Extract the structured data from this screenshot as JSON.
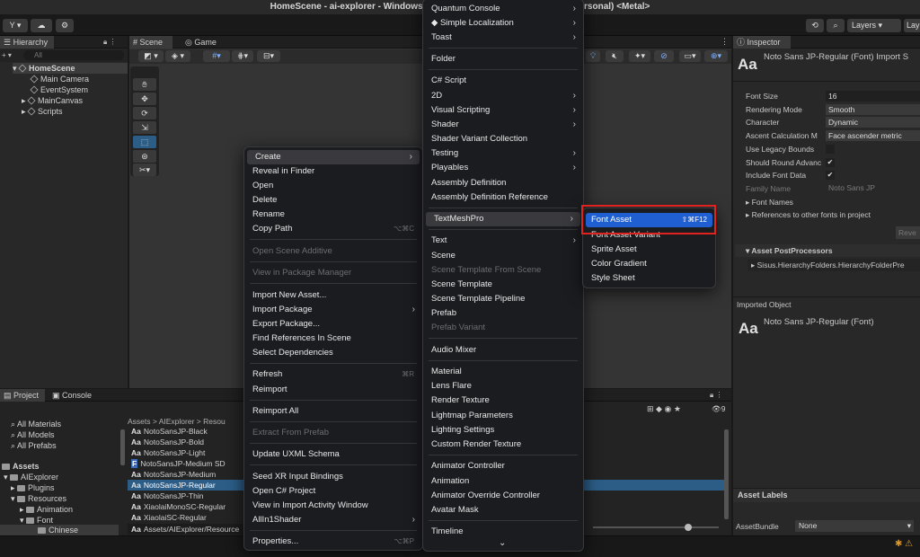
{
  "window": {
    "title": "HomeScene - ai-explorer - Windows, Mac, Linux - Unity 2022 Personal (Personal) <Metal>"
  },
  "toolbar": {
    "account": "Y ▾",
    "layers_label": "Layers",
    "layout_label": "Lay"
  },
  "hierarchy": {
    "tab": "Hierarchy",
    "search_placeholder": "All",
    "items": [
      {
        "label": "HomeScene"
      },
      {
        "label": "Main Camera"
      },
      {
        "label": "EventSystem"
      },
      {
        "label": "MainCanvas"
      },
      {
        "label": "Scripts"
      }
    ]
  },
  "scene": {
    "tabs": [
      {
        "label": "Scene"
      },
      {
        "label": "Game"
      }
    ]
  },
  "project": {
    "tabs": [
      {
        "label": "Project"
      },
      {
        "label": "Console"
      }
    ],
    "favorites": [
      {
        "label": "All Materials"
      },
      {
        "label": "All Models"
      },
      {
        "label": "All Prefabs"
      }
    ],
    "tree": [
      {
        "label": "Assets"
      },
      {
        "label": "AIExplorer"
      },
      {
        "label": "Plugins"
      },
      {
        "label": "Resources"
      },
      {
        "label": "Animation"
      },
      {
        "label": "Font"
      },
      {
        "label": "Chinese"
      }
    ],
    "breadcrumb": "Assets > AIExplorer > Resou",
    "files": [
      {
        "label": "NotoSansJP-Black"
      },
      {
        "label": "NotoSansJP-Bold"
      },
      {
        "label": "NotoSansJP-Light"
      },
      {
        "label": "NotoSansJP-Medium SD"
      },
      {
        "label": "NotoSansJP-Medium"
      },
      {
        "label": "NotoSansJP-Regular"
      },
      {
        "label": "NotoSansJP-Thin"
      },
      {
        "label": "XiaolaiMonoSC-Regular"
      },
      {
        "label": "XiaolaiSC-Regular"
      }
    ],
    "path": "Assets/AIExplorer/Resource",
    "count": "9"
  },
  "context_menu": {
    "items": [
      {
        "label": "Create"
      },
      {
        "label": "Reveal in Finder"
      },
      {
        "label": "Open"
      },
      {
        "label": "Delete"
      },
      {
        "label": "Rename"
      },
      {
        "label": "Copy Path",
        "shortcut": "⌥⌘C"
      },
      {
        "label": "Open Scene Additive"
      },
      {
        "label": "View in Package Manager"
      },
      {
        "label": "Import New Asset..."
      },
      {
        "label": "Import Package"
      },
      {
        "label": "Export Package..."
      },
      {
        "label": "Find References In Scene"
      },
      {
        "label": "Select Dependencies"
      },
      {
        "label": "Refresh",
        "shortcut": "⌘R"
      },
      {
        "label": "Reimport"
      },
      {
        "label": "Reimport All"
      },
      {
        "label": "Extract From Prefab"
      },
      {
        "label": "Update UXML Schema"
      },
      {
        "label": "Seed XR Input Bindings"
      },
      {
        "label": "Open C# Project"
      },
      {
        "label": "View in Import Activity Window"
      },
      {
        "label": "AllIn1Shader"
      },
      {
        "label": "Properties...",
        "shortcut": "⌥⌘P"
      }
    ]
  },
  "create_menu": {
    "items": [
      {
        "label": "Quantum Console"
      },
      {
        "label": "◆ Simple Localization"
      },
      {
        "label": "Toast"
      },
      {
        "label": "Folder"
      },
      {
        "label": "C# Script"
      },
      {
        "label": "2D"
      },
      {
        "label": "Visual Scripting"
      },
      {
        "label": "Shader"
      },
      {
        "label": "Shader Variant Collection"
      },
      {
        "label": "Testing"
      },
      {
        "label": "Playables"
      },
      {
        "label": "Assembly Definition"
      },
      {
        "label": "Assembly Definition Reference"
      },
      {
        "label": "TextMeshPro"
      },
      {
        "label": "Text"
      },
      {
        "label": "Scene"
      },
      {
        "label": "Scene Template From Scene"
      },
      {
        "label": "Scene Template"
      },
      {
        "label": "Scene Template Pipeline"
      },
      {
        "label": "Prefab"
      },
      {
        "label": "Prefab Variant"
      },
      {
        "label": "Audio Mixer"
      },
      {
        "label": "Material"
      },
      {
        "label": "Lens Flare"
      },
      {
        "label": "Render Texture"
      },
      {
        "label": "Lightmap Parameters"
      },
      {
        "label": "Lighting Settings"
      },
      {
        "label": "Custom Render Texture"
      },
      {
        "label": "Animator Controller"
      },
      {
        "label": "Animation"
      },
      {
        "label": "Animator Override Controller"
      },
      {
        "label": "Avatar Mask"
      },
      {
        "label": "Timeline"
      }
    ]
  },
  "tmp_menu": {
    "items": [
      {
        "label": "Font Asset",
        "shortcut": "⇧⌘F12"
      },
      {
        "label": "Font Asset Variant"
      },
      {
        "label": "Sprite Asset"
      },
      {
        "label": "Color Gradient"
      },
      {
        "label": "Style Sheet"
      }
    ]
  },
  "inspector": {
    "tab": "Inspector",
    "title": "Noto Sans JP-Regular (Font) Import S",
    "icon_text": "Aa",
    "props": [
      {
        "label": "Font Size",
        "value": "16"
      },
      {
        "label": "Rendering Mode",
        "value": "Smooth"
      },
      {
        "label": "Character",
        "value": "Dynamic"
      },
      {
        "label": "Ascent Calculation M",
        "value": "Face ascender metric"
      },
      {
        "label": "Use Legacy Bounds"
      },
      {
        "label": "Should Round Advanc",
        "check": "✔"
      },
      {
        "label": "Include Font Data",
        "check": "✔"
      },
      {
        "label": "Family Name",
        "value": "Noto Sans JP"
      }
    ],
    "font_names": "Font Names",
    "refs": "References to other fonts in project",
    "revert": "Reve",
    "postprocessors": "Asset PostProcessors",
    "pp_item": "Sisus.HierarchyFolders.HierarchyFolderPre",
    "imported_label": "Imported Object",
    "imported_title": "Noto Sans JP-Regular (Font)",
    "asset_labels": "Asset Labels",
    "assetbundle_label": "AssetBundle",
    "assetbundle_value": "None"
  },
  "colors": {
    "highlight": "#1f5fd1",
    "red_box": "#e0231f",
    "selection": "#2c5d87"
  }
}
